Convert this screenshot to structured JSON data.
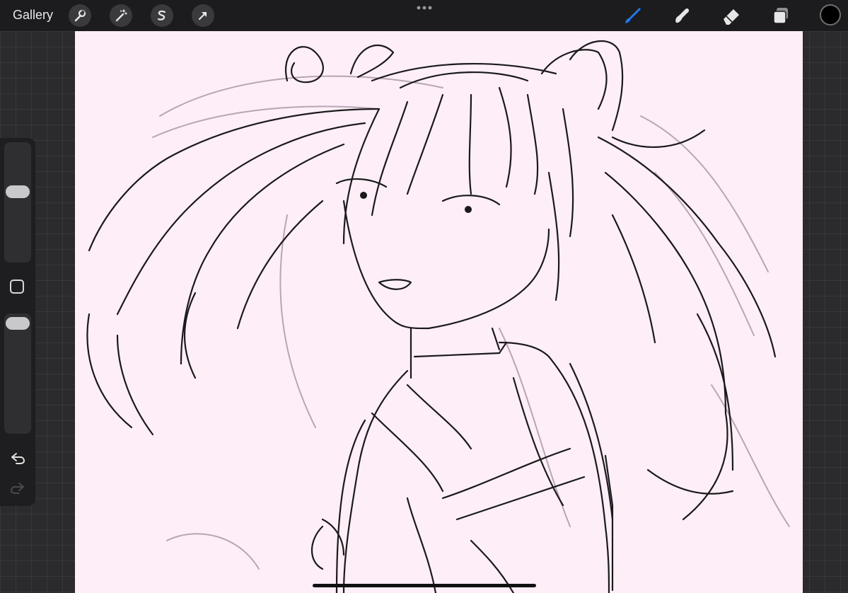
{
  "topbar": {
    "gallery_label": "Gallery",
    "left_tools": [
      {
        "name": "actions",
        "icon": "wrench-icon"
      },
      {
        "name": "adjustments",
        "icon": "magic-wand-icon"
      },
      {
        "name": "selection",
        "icon": "selection-s-icon"
      },
      {
        "name": "transform",
        "icon": "arrow-cursor-icon"
      }
    ],
    "right_tools": [
      {
        "name": "brush",
        "icon": "brush-icon",
        "active": true,
        "color": "#1e7cf2"
      },
      {
        "name": "smudge",
        "icon": "smudge-icon",
        "active": false
      },
      {
        "name": "eraser",
        "icon": "eraser-icon",
        "active": false
      },
      {
        "name": "layers",
        "icon": "layers-icon",
        "active": false
      }
    ],
    "current_color": "#000000"
  },
  "sidebar": {
    "brush_size_level": 0.35,
    "brush_opacity_level": 0.1,
    "buttons": [
      "modify-button",
      "undo-button",
      "redo-button"
    ]
  },
  "canvas": {
    "background_color": "#fdeef8"
  }
}
